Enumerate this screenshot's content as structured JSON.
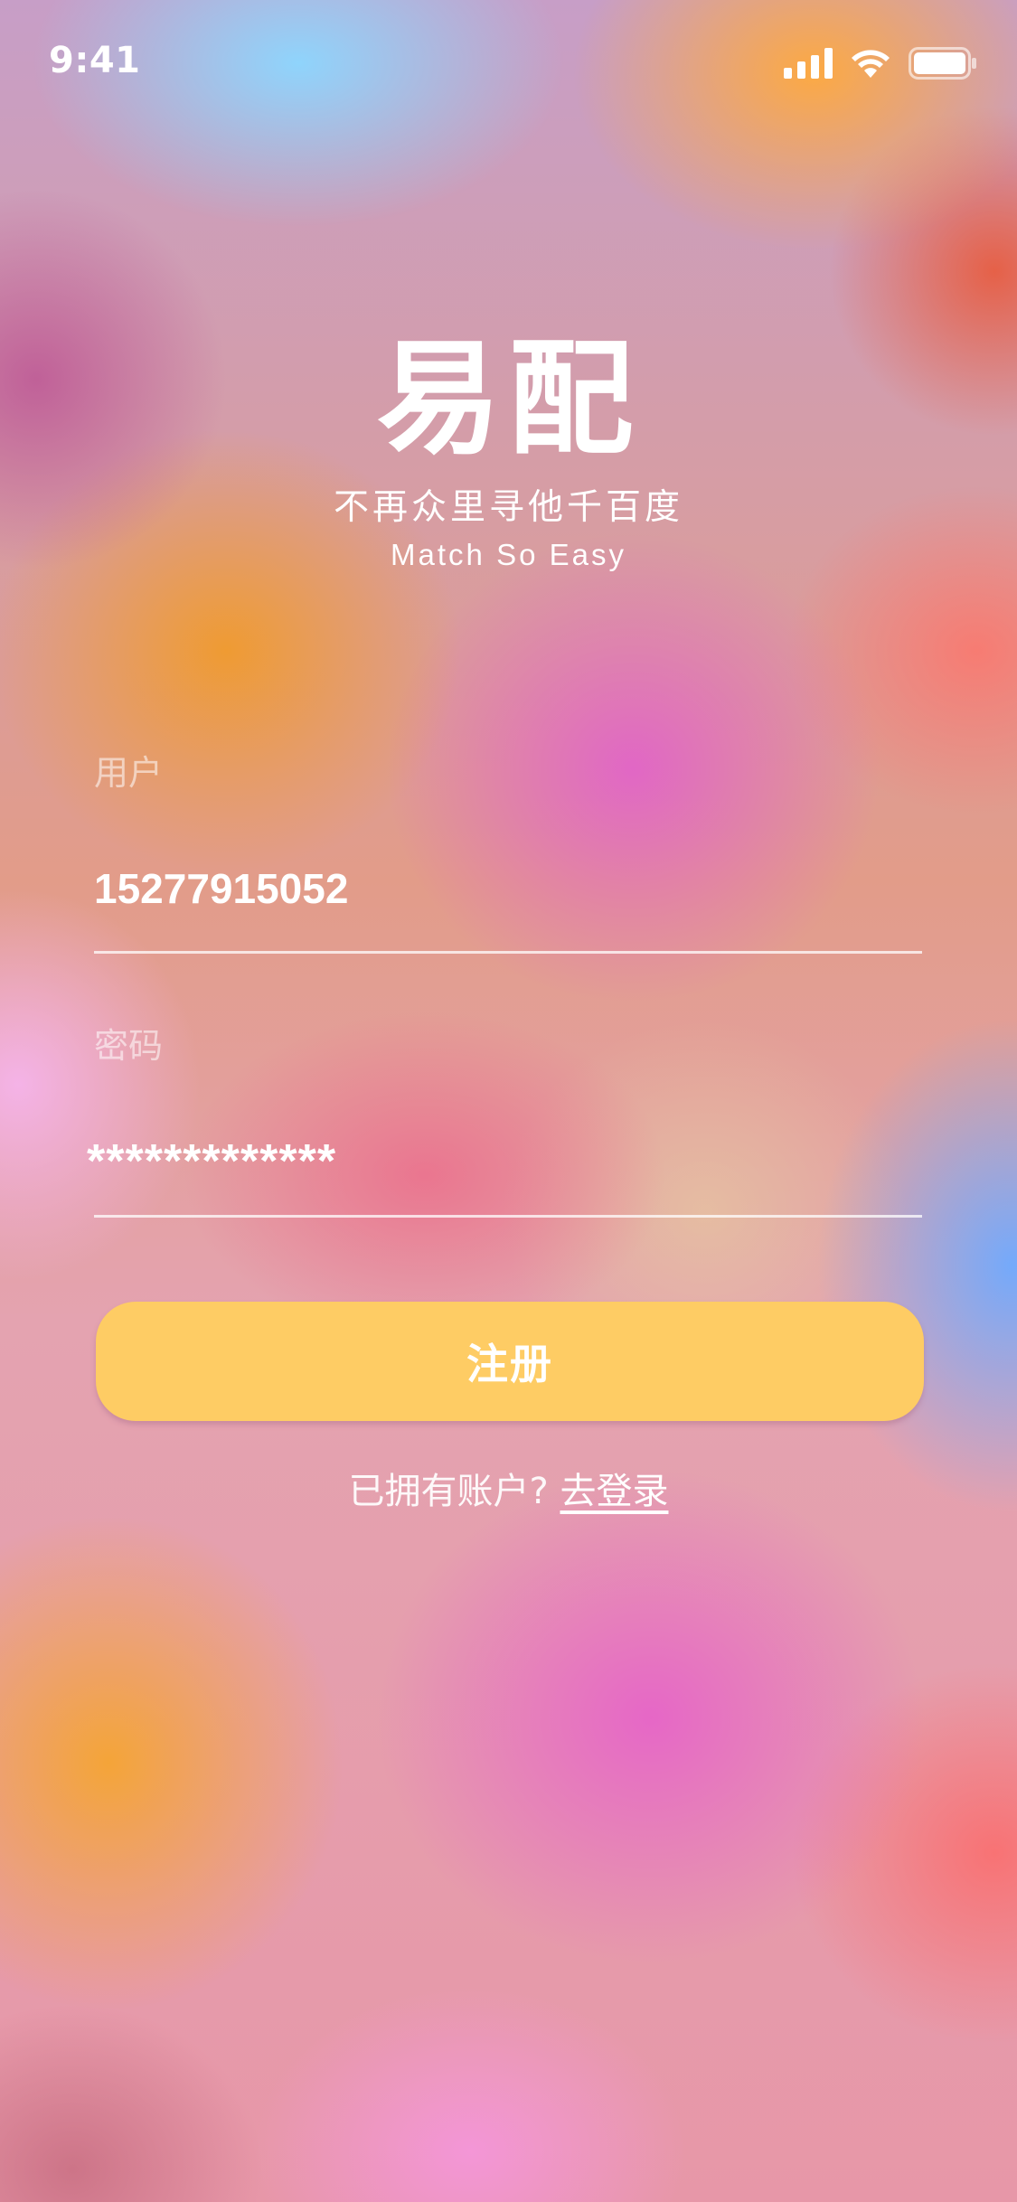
{
  "status_bar": {
    "time": "9:41",
    "icons": [
      "signal-icon",
      "wifi-icon",
      "battery-icon"
    ]
  },
  "brand": {
    "title": "易配",
    "subtitle": "不再众里寻他千百度",
    "tagline": "Match So Easy"
  },
  "form": {
    "user_label": "用户",
    "user_value": "15277915052",
    "password_label": "密码",
    "password_value": "*************",
    "register_button_label": "注册"
  },
  "footer": {
    "prompt_text": "已拥有账户?",
    "login_link_label": "去登录"
  },
  "colors": {
    "button_background": "#fecc64",
    "text": "#ffffff"
  }
}
